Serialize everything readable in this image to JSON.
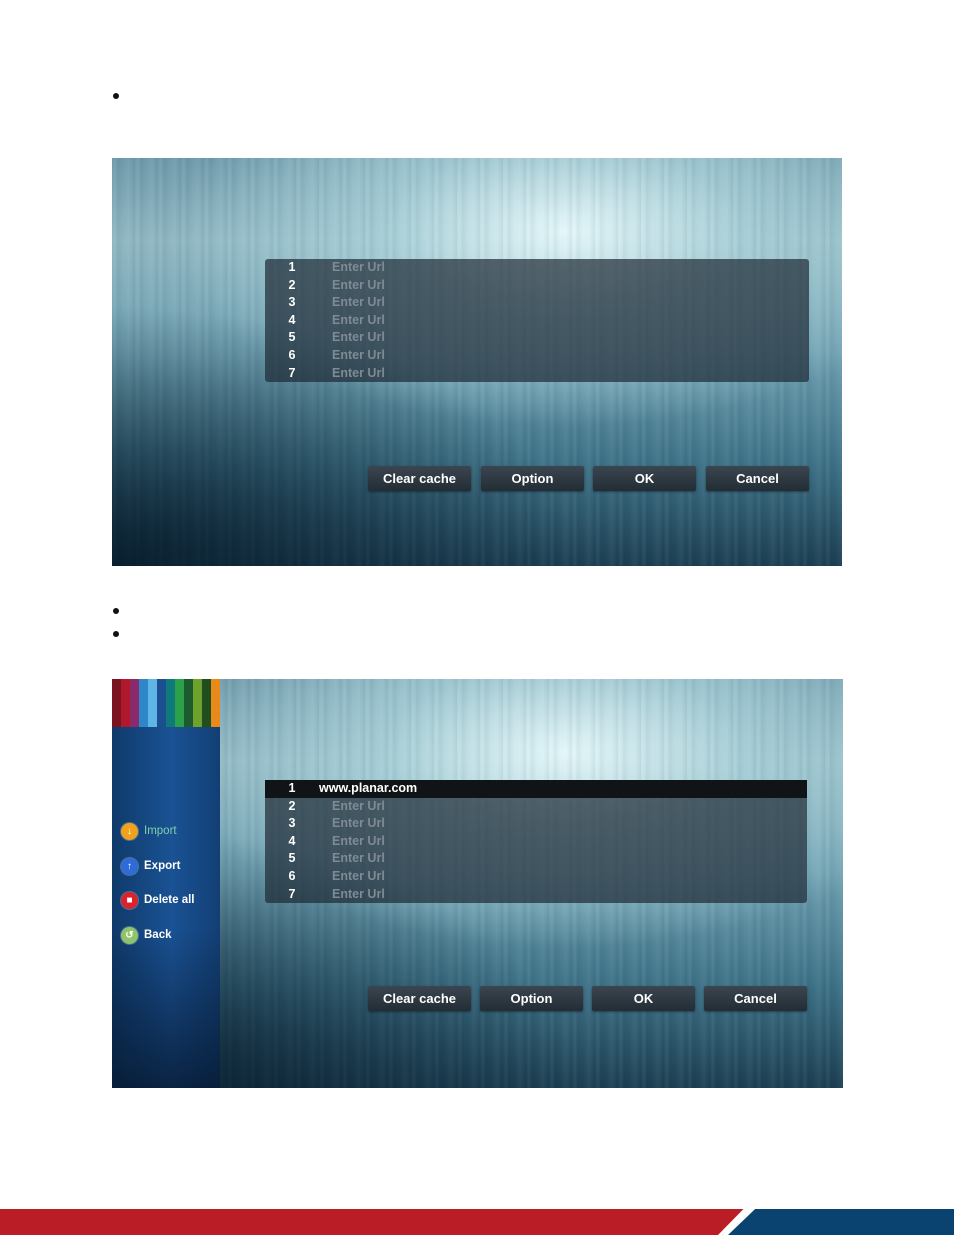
{
  "screen1": {
    "rows": [
      {
        "num": "1",
        "url": "Enter Url"
      },
      {
        "num": "2",
        "url": "Enter Url"
      },
      {
        "num": "3",
        "url": "Enter Url"
      },
      {
        "num": "4",
        "url": "Enter Url"
      },
      {
        "num": "5",
        "url": "Enter Url"
      },
      {
        "num": "6",
        "url": "Enter Url"
      },
      {
        "num": "7",
        "url": "Enter Url"
      }
    ],
    "buttons": {
      "clear_cache": "Clear cache",
      "option": "Option",
      "ok": "OK",
      "cancel": "Cancel"
    }
  },
  "screen2": {
    "sidebar": {
      "items": [
        {
          "label": "Import",
          "icon": "download-icon",
          "color": "#f0a21c"
        },
        {
          "label": "Export",
          "icon": "upload-icon",
          "color": "#2f6bd8"
        },
        {
          "label": "Delete all",
          "icon": "trash-icon",
          "color": "#d9232d"
        },
        {
          "label": "Back",
          "icon": "back-arrow-icon",
          "color": "#8fc46a"
        }
      ],
      "active_color": "#7fd0a8"
    },
    "rows": [
      {
        "num": "1",
        "url": "www.planar.com"
      },
      {
        "num": "2",
        "url": "Enter Url"
      },
      {
        "num": "3",
        "url": "Enter Url"
      },
      {
        "num": "4",
        "url": "Enter Url"
      },
      {
        "num": "5",
        "url": "Enter Url"
      },
      {
        "num": "6",
        "url": "Enter Url"
      },
      {
        "num": "7",
        "url": "Enter Url"
      }
    ],
    "buttons": {
      "clear_cache": "Clear cache",
      "option": "Option",
      "ok": "OK",
      "cancel": "Cancel"
    }
  },
  "colors": {
    "footer_red": "#bb1d26",
    "footer_blue": "#0a4370"
  }
}
